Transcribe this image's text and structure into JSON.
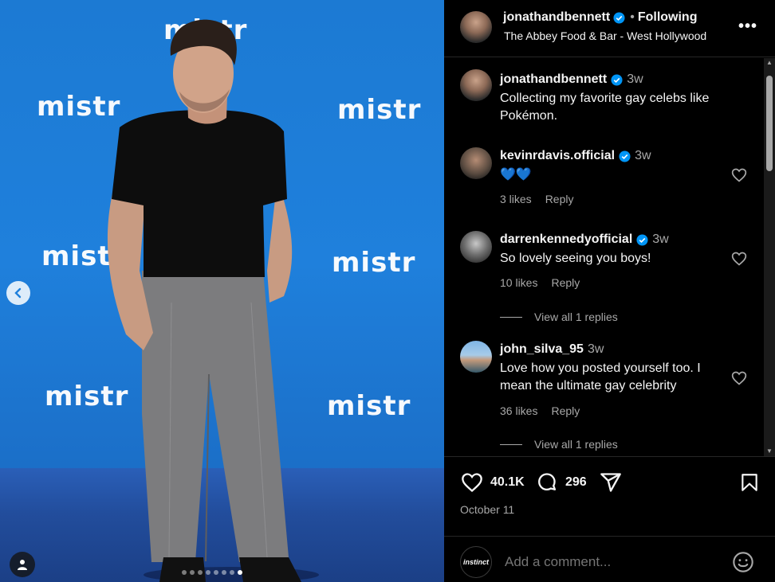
{
  "photo": {
    "backdrop_logos": [
      "mistr",
      "mistr",
      "mistr",
      "mistr",
      "mistr",
      "mistr",
      "mistr"
    ],
    "carousel_dots_total": 8,
    "carousel_active_index": 7
  },
  "header": {
    "username": "jonathandbennett",
    "separator": "•",
    "follow_status": "Following",
    "location": "The Abbey Food & Bar - West Hollywood",
    "more_label": "•••"
  },
  "comments": [
    {
      "username": "jonathandbennett",
      "verified": true,
      "time": "3w",
      "text": "Collecting my favorite gay celebs like Pokémon."
    },
    {
      "username": "kevinrdavis.official",
      "verified": true,
      "time": "3w",
      "text": "💙💙",
      "likes": "3 likes",
      "reply": "Reply"
    },
    {
      "username": "darrenkennedyofficial",
      "verified": true,
      "time": "3w",
      "text": "So lovely seeing you boys!",
      "likes": "10 likes",
      "reply": "Reply",
      "view_replies": "View all 1 replies"
    },
    {
      "username": "john_silva_95",
      "verified": false,
      "time": "3w",
      "text": "Love how you posted yourself too. I mean the ultimate gay celebrity",
      "likes": "36 likes",
      "reply": "Reply",
      "view_replies": "View all 1 replies"
    }
  ],
  "actions": {
    "like_count": "40.1K",
    "comment_count": "296",
    "date": "October 11"
  },
  "add_comment": {
    "placeholder": "Add a comment...",
    "avatar_text": "instinct"
  },
  "colors": {
    "verified_blue": "#0095f6",
    "backdrop_blue": "#1f80dc",
    "text_secondary": "#a8a8a8"
  },
  "icons": [
    "chevron-left-icon",
    "user-tag-icon",
    "more-icon",
    "heart-icon",
    "comment-icon",
    "share-icon",
    "bookmark-icon",
    "emoji-icon",
    "verified-icon"
  ]
}
